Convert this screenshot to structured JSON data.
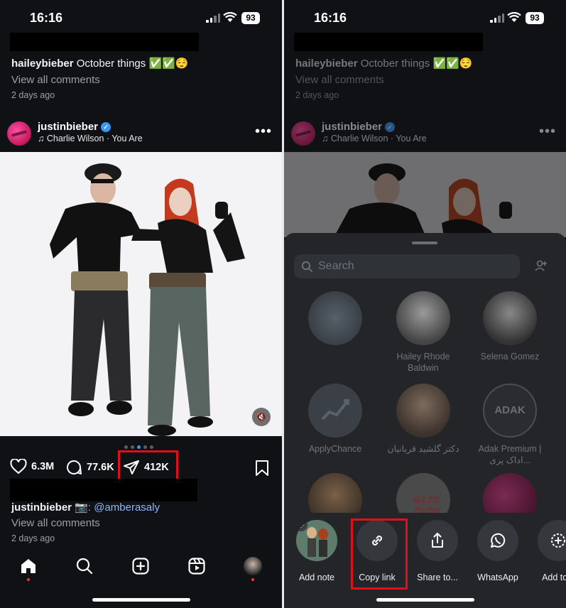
{
  "status_bar": {
    "time": "16:16",
    "battery": "93"
  },
  "feed": {
    "top_caption": {
      "username": "haileybieber",
      "text": "October things ✅✅😌"
    },
    "view_comments": "View all comments",
    "top_time": "2 days ago",
    "post": {
      "username": "justinbieber",
      "audio": "Charlie Wilson · You Are",
      "more": "•••",
      "likes": "6.3M",
      "comments": "77.6K",
      "shares": "412K",
      "caption_user": "justinbieber",
      "caption_text": "📷: @amberasaly",
      "view_comments": "View all comments",
      "time": "2 days ago"
    }
  },
  "share_sheet": {
    "search_placeholder": "Search",
    "contacts": [
      {
        "name": ""
      },
      {
        "name": "Hailey Rhode Baldwin"
      },
      {
        "name": "Selena Gomez"
      },
      {
        "name": "ApplyChance"
      },
      {
        "name": "دکتر گلشید قربانیان"
      },
      {
        "name": "Adak Premium | اداک پری..."
      }
    ],
    "contact_logos": {
      "adak": "ADAK",
      "ielts": "IELTS Turbo"
    },
    "actions": [
      {
        "label": "Add note"
      },
      {
        "label": "Copy link"
      },
      {
        "label": "Share to..."
      },
      {
        "label": "WhatsApp"
      },
      {
        "label": "Add to s"
      }
    ]
  },
  "colors": {
    "highlight_red": "#e0101a",
    "verified_blue": "#3897f0",
    "background": "#0f1115"
  }
}
